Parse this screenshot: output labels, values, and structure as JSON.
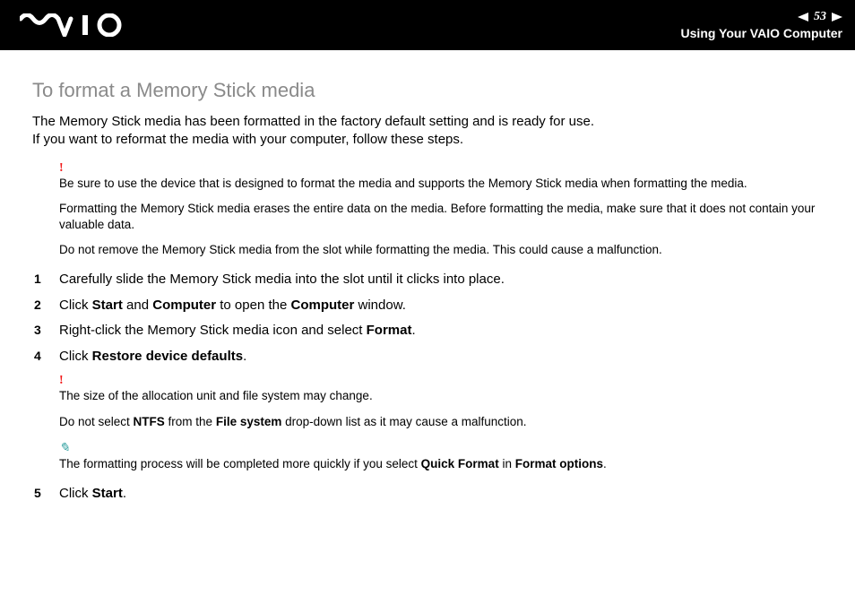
{
  "header": {
    "page_number": "53",
    "section": "Using Your VAIO Computer"
  },
  "title": "To format a Memory Stick media",
  "intro_line1": "The Memory Stick media has been formatted in the factory default setting and is ready for use.",
  "intro_line2": "If you want to reformat the media with your computer, follow these steps.",
  "warning1": {
    "p1": "Be sure to use the device that is designed to format the media and supports the Memory Stick media when formatting the media.",
    "p2": "Formatting the Memory Stick media erases the entire data on the media. Before formatting the media, make sure that it does not contain your valuable data.",
    "p3": "Do not remove the Memory Stick media from the slot while formatting the media. This could cause a malfunction."
  },
  "steps": {
    "s1": {
      "num": "1",
      "pre": "Carefully slide the Memory Stick media into the slot until it clicks into place."
    },
    "s2": {
      "num": "2"
    },
    "s3": {
      "num": "3"
    },
    "s4": {
      "num": "4"
    },
    "s5": {
      "num": "5"
    }
  },
  "step2_parts": {
    "a": "Click ",
    "b": "Start",
    "c": " and ",
    "d": "Computer",
    "e": " to open the ",
    "f": "Computer",
    "g": " window."
  },
  "step3_parts": {
    "a": "Right-click the Memory Stick media icon and select ",
    "b": "Format",
    "c": "."
  },
  "step4_parts": {
    "a": "Click ",
    "b": "Restore device defaults",
    "c": "."
  },
  "step5_parts": {
    "a": "Click ",
    "b": "Start",
    "c": "."
  },
  "warning2": {
    "p1": "The size of the allocation unit and file system may change.",
    "p2a": "Do not select ",
    "p2b": "NTFS",
    "p2c": " from the ",
    "p2d": "File system",
    "p2e": " drop-down list as it may cause a malfunction."
  },
  "tip": {
    "a": "The formatting process will be completed more quickly if you select ",
    "b": "Quick Format",
    "c": " in ",
    "d": "Format options",
    "e": "."
  }
}
